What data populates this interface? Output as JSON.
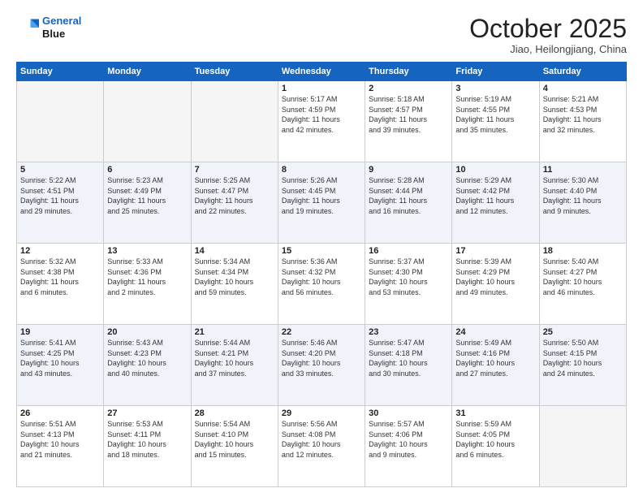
{
  "header": {
    "logo_line1": "General",
    "logo_line2": "Blue",
    "month": "October 2025",
    "location": "Jiao, Heilongjiang, China"
  },
  "weekdays": [
    "Sunday",
    "Monday",
    "Tuesday",
    "Wednesday",
    "Thursday",
    "Friday",
    "Saturday"
  ],
  "weeks": [
    [
      {
        "day": "",
        "info": ""
      },
      {
        "day": "",
        "info": ""
      },
      {
        "day": "",
        "info": ""
      },
      {
        "day": "1",
        "info": "Sunrise: 5:17 AM\nSunset: 4:59 PM\nDaylight: 11 hours\nand 42 minutes."
      },
      {
        "day": "2",
        "info": "Sunrise: 5:18 AM\nSunset: 4:57 PM\nDaylight: 11 hours\nand 39 minutes."
      },
      {
        "day": "3",
        "info": "Sunrise: 5:19 AM\nSunset: 4:55 PM\nDaylight: 11 hours\nand 35 minutes."
      },
      {
        "day": "4",
        "info": "Sunrise: 5:21 AM\nSunset: 4:53 PM\nDaylight: 11 hours\nand 32 minutes."
      }
    ],
    [
      {
        "day": "5",
        "info": "Sunrise: 5:22 AM\nSunset: 4:51 PM\nDaylight: 11 hours\nand 29 minutes."
      },
      {
        "day": "6",
        "info": "Sunrise: 5:23 AM\nSunset: 4:49 PM\nDaylight: 11 hours\nand 25 minutes."
      },
      {
        "day": "7",
        "info": "Sunrise: 5:25 AM\nSunset: 4:47 PM\nDaylight: 11 hours\nand 22 minutes."
      },
      {
        "day": "8",
        "info": "Sunrise: 5:26 AM\nSunset: 4:45 PM\nDaylight: 11 hours\nand 19 minutes."
      },
      {
        "day": "9",
        "info": "Sunrise: 5:28 AM\nSunset: 4:44 PM\nDaylight: 11 hours\nand 16 minutes."
      },
      {
        "day": "10",
        "info": "Sunrise: 5:29 AM\nSunset: 4:42 PM\nDaylight: 11 hours\nand 12 minutes."
      },
      {
        "day": "11",
        "info": "Sunrise: 5:30 AM\nSunset: 4:40 PM\nDaylight: 11 hours\nand 9 minutes."
      }
    ],
    [
      {
        "day": "12",
        "info": "Sunrise: 5:32 AM\nSunset: 4:38 PM\nDaylight: 11 hours\nand 6 minutes."
      },
      {
        "day": "13",
        "info": "Sunrise: 5:33 AM\nSunset: 4:36 PM\nDaylight: 11 hours\nand 2 minutes."
      },
      {
        "day": "14",
        "info": "Sunrise: 5:34 AM\nSunset: 4:34 PM\nDaylight: 10 hours\nand 59 minutes."
      },
      {
        "day": "15",
        "info": "Sunrise: 5:36 AM\nSunset: 4:32 PM\nDaylight: 10 hours\nand 56 minutes."
      },
      {
        "day": "16",
        "info": "Sunrise: 5:37 AM\nSunset: 4:30 PM\nDaylight: 10 hours\nand 53 minutes."
      },
      {
        "day": "17",
        "info": "Sunrise: 5:39 AM\nSunset: 4:29 PM\nDaylight: 10 hours\nand 49 minutes."
      },
      {
        "day": "18",
        "info": "Sunrise: 5:40 AM\nSunset: 4:27 PM\nDaylight: 10 hours\nand 46 minutes."
      }
    ],
    [
      {
        "day": "19",
        "info": "Sunrise: 5:41 AM\nSunset: 4:25 PM\nDaylight: 10 hours\nand 43 minutes."
      },
      {
        "day": "20",
        "info": "Sunrise: 5:43 AM\nSunset: 4:23 PM\nDaylight: 10 hours\nand 40 minutes."
      },
      {
        "day": "21",
        "info": "Sunrise: 5:44 AM\nSunset: 4:21 PM\nDaylight: 10 hours\nand 37 minutes."
      },
      {
        "day": "22",
        "info": "Sunrise: 5:46 AM\nSunset: 4:20 PM\nDaylight: 10 hours\nand 33 minutes."
      },
      {
        "day": "23",
        "info": "Sunrise: 5:47 AM\nSunset: 4:18 PM\nDaylight: 10 hours\nand 30 minutes."
      },
      {
        "day": "24",
        "info": "Sunrise: 5:49 AM\nSunset: 4:16 PM\nDaylight: 10 hours\nand 27 minutes."
      },
      {
        "day": "25",
        "info": "Sunrise: 5:50 AM\nSunset: 4:15 PM\nDaylight: 10 hours\nand 24 minutes."
      }
    ],
    [
      {
        "day": "26",
        "info": "Sunrise: 5:51 AM\nSunset: 4:13 PM\nDaylight: 10 hours\nand 21 minutes."
      },
      {
        "day": "27",
        "info": "Sunrise: 5:53 AM\nSunset: 4:11 PM\nDaylight: 10 hours\nand 18 minutes."
      },
      {
        "day": "28",
        "info": "Sunrise: 5:54 AM\nSunset: 4:10 PM\nDaylight: 10 hours\nand 15 minutes."
      },
      {
        "day": "29",
        "info": "Sunrise: 5:56 AM\nSunset: 4:08 PM\nDaylight: 10 hours\nand 12 minutes."
      },
      {
        "day": "30",
        "info": "Sunrise: 5:57 AM\nSunset: 4:06 PM\nDaylight: 10 hours\nand 9 minutes."
      },
      {
        "day": "31",
        "info": "Sunrise: 5:59 AM\nSunset: 4:05 PM\nDaylight: 10 hours\nand 6 minutes."
      },
      {
        "day": "",
        "info": ""
      }
    ]
  ]
}
